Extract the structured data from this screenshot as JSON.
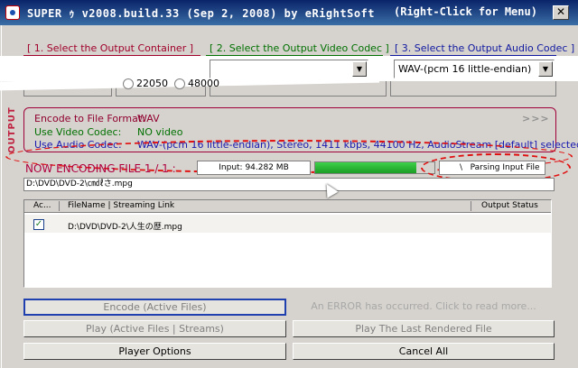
{
  "window": {
    "title": "SUPER ｩ v2008.build.33 (Sep 2, 2008) by eRightSoft",
    "menu_hint": "(Right-Click for Menu)",
    "close_glyph": "✕"
  },
  "sections": {
    "container_label": "[ 1.     Select the Output Container ]",
    "video_label": "[ 2.   Select the Output Video Codec ]",
    "audio_label": "[ 3.   Select the Output Audio Codec ]"
  },
  "audio": {
    "codec_value": "WAV-(pcm 16 little-endian)",
    "sample_rates": [
      "22050",
      "48000"
    ]
  },
  "output": {
    "side_label": "OUTPUT",
    "format_key": "Encode to File Format:",
    "format_value": "WAV",
    "video_key": "Use Video Codec:",
    "video_value": "NO video",
    "audio_key": "Use Audio Codec:",
    "audio_value": "WAV-(pcm 16 little-endian),  Stereo,  1411 kbps,  44100 Hz,  AudioStream [default] selected",
    "more_arrows": ">>>"
  },
  "encoding": {
    "label": "NOW ENCODING FILE 1 / 1 :",
    "input_size": "Input: 94.282 MB",
    "progress_fraction": 0.85,
    "status_spinner": "\\",
    "status_text": "Parsing Input File",
    "current_path": "D:\\DVD\\DVD-2\\㎝㎗さ.mpg"
  },
  "file_list": {
    "columns": [
      "Ac...",
      "FileName  |  Streaming Link",
      "Output Status"
    ],
    "rows": [
      {
        "checked": "✓",
        "file": "D:\\DVD\\DVD-2\\人生の歴.mpg"
      }
    ]
  },
  "buttons": {
    "encode": "Encode (Active Files)",
    "error": "An ERROR has occurred. Click to read more...",
    "play_active": "Play (Active Files | Streams)",
    "play_last": "Play The Last Rendered File",
    "player_options": "Player Options",
    "cancel_all": "Cancel All"
  },
  "colors": {
    "container_accent": "#a0002a",
    "video_accent": "#007000",
    "audio_accent": "#1018a0",
    "annotation_red": "#e01010",
    "progress_green": "#1a9e24"
  }
}
